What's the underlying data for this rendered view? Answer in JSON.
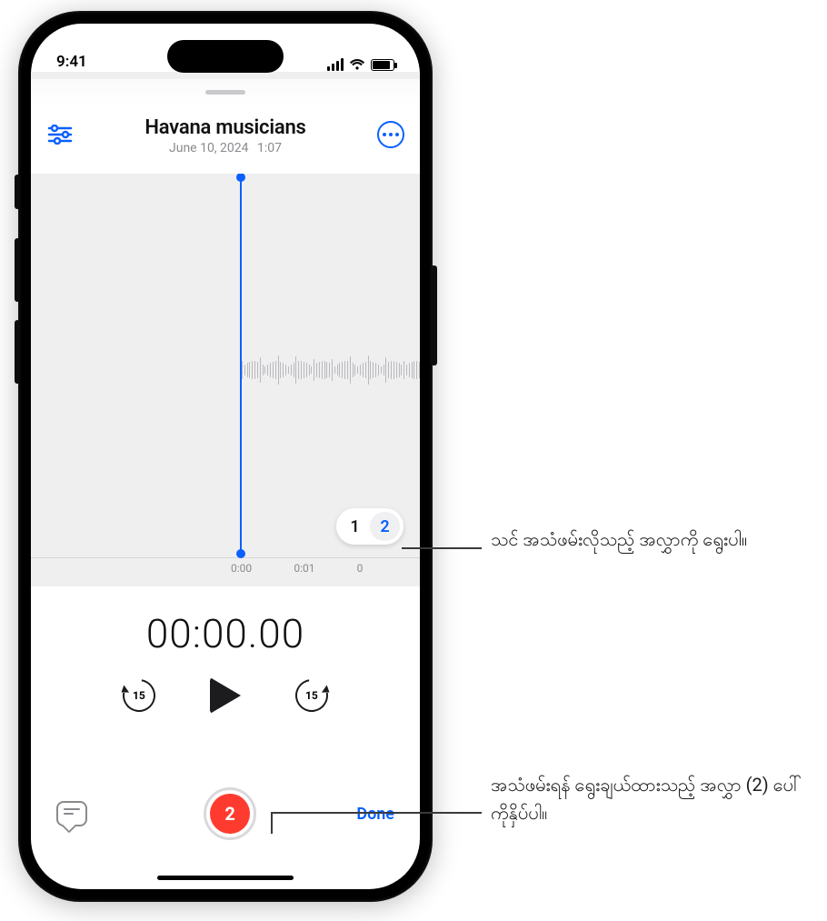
{
  "status": {
    "time": "9:41"
  },
  "header": {
    "title": "Havana musicians",
    "date": "June 10, 2024",
    "duration": "1:07"
  },
  "waveform": {
    "ruler": [
      "0:00",
      "0:01",
      "0"
    ]
  },
  "layers": {
    "opt1": "1",
    "opt2": "2"
  },
  "timer": "00:00.00",
  "skip": {
    "back_secs": "15",
    "fwd_secs": "15"
  },
  "record": {
    "layer_badge": "2"
  },
  "done_label": "Done",
  "callouts": {
    "layer_select": "သင် အသံဖမ်းလိုသည့် အလွှာကို ရွေးပါ။",
    "record_layer": "အသံဖမ်းရန် ရွေးချယ်ထားသည့် အလွှာ (2) ပေါ် ကိုနှိပ်ပါ။"
  }
}
